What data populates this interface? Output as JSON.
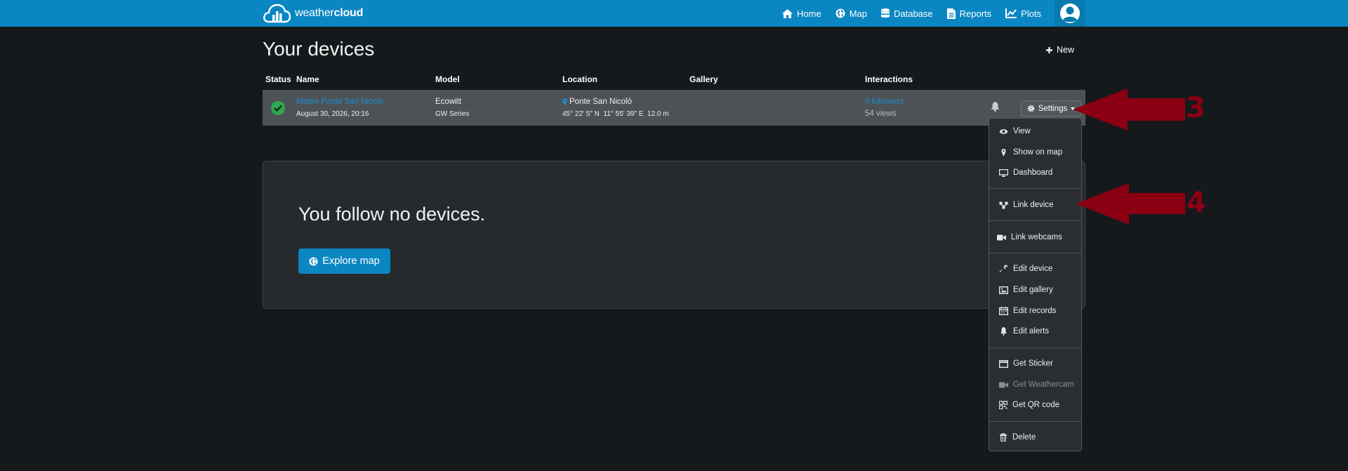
{
  "brand": {
    "name_light": "weather",
    "name_bold": "cloud"
  },
  "nav": {
    "items": [
      {
        "label": "Home",
        "icon": "home-icon"
      },
      {
        "label": "Map",
        "icon": "globe-icon"
      },
      {
        "label": "Database",
        "icon": "database-icon"
      },
      {
        "label": "Reports",
        "icon": "file-icon"
      },
      {
        "label": "Plots",
        "icon": "line-chart-icon"
      }
    ],
    "avatar_icon": "user-avatar-icon"
  },
  "page": {
    "title": "Your devices",
    "new_label": "New"
  },
  "table": {
    "headers": {
      "status": "Status",
      "name": "Name",
      "model": "Model",
      "location": "Location",
      "gallery": "Gallery",
      "interactions": "Interactions"
    },
    "row": {
      "name": "Meteo Ponte San Nicolò",
      "timestamp": "August 30, 2026, 20:16",
      "model": "Ecowitt",
      "series": "GW Series",
      "location": "Ponte San Nicolò",
      "coordinates": "45° 22' 5\" N  11° 55' 39\" E  12.0 m",
      "followers": "0 followers",
      "views": "54 views",
      "settings_label": "Settings"
    }
  },
  "follow": {
    "text": "You follow no devices.",
    "button": "Explore map"
  },
  "menu": {
    "view": "View",
    "show_on_map": "Show on map",
    "dashboard": "Dashboard",
    "link_device": "Link device",
    "link_webcams": "Link webcams",
    "edit_device": "Edit device",
    "edit_gallery": "Edit gallery",
    "edit_records": "Edit records",
    "edit_alerts": "Edit alerts",
    "get_sticker": "Get Sticker",
    "get_weathercam": "Get Weathercam",
    "get_qr_code": "Get QR code",
    "delete": "Delete"
  },
  "annotations": {
    "step3": "3",
    "step4": "4"
  },
  "colors": {
    "navbar": "#0a86c2",
    "accent_link": "#1d8fd0",
    "status_ok": "#2fa84f",
    "annotation": "#8b0012"
  }
}
